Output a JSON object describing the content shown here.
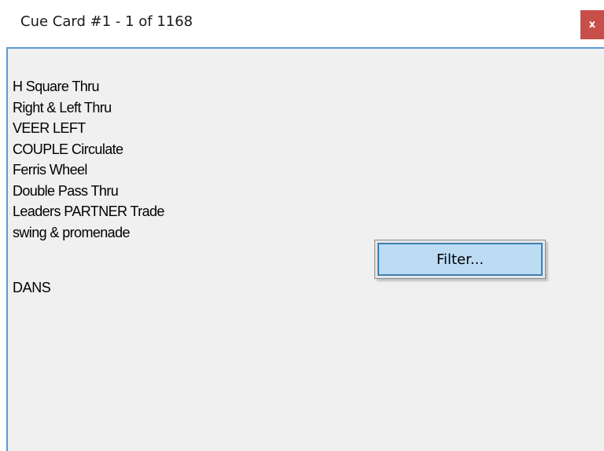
{
  "window": {
    "title": "Cue Card #1 - 1 of 1168",
    "close_label": "x"
  },
  "cue_card": {
    "lines": [
      "H Square Thru",
      "Right & Left Thru",
      "VEER LEFT",
      "COUPLE Circulate",
      "Ferris Wheel",
      "Double Pass Thru",
      "Leaders PARTNER Trade",
      "swing & promenade"
    ],
    "signature": "DANS"
  },
  "actions": {
    "filter_label": "Filter..."
  },
  "colors": {
    "close_button_bg": "#c84e4a",
    "content_bg": "#f0f0f0",
    "button_highlight": "#bcdcf4",
    "focus_border": "#3c7fb1"
  }
}
